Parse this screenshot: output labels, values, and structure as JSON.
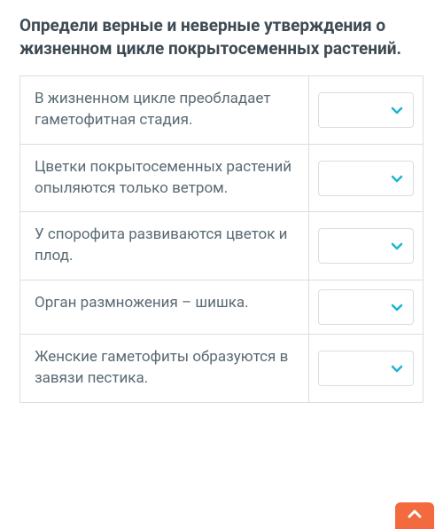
{
  "title": "Определи верные и неверные утверждения о жизненном цикле покрытосеменных растений.",
  "rows": [
    {
      "statement": "В жизненном цикле преобладает гаметофитная стадия.",
      "value": ""
    },
    {
      "statement": "Цветки покрытосеменных растений опыляются только ветром.",
      "value": ""
    },
    {
      "statement": "У спорофита развиваются цветок и плод.",
      "value": ""
    },
    {
      "statement": "Орган размножения – шишка.",
      "value": ""
    },
    {
      "statement": "Женские гаметофиты образуются в завязи пестика.",
      "value": ""
    }
  ]
}
